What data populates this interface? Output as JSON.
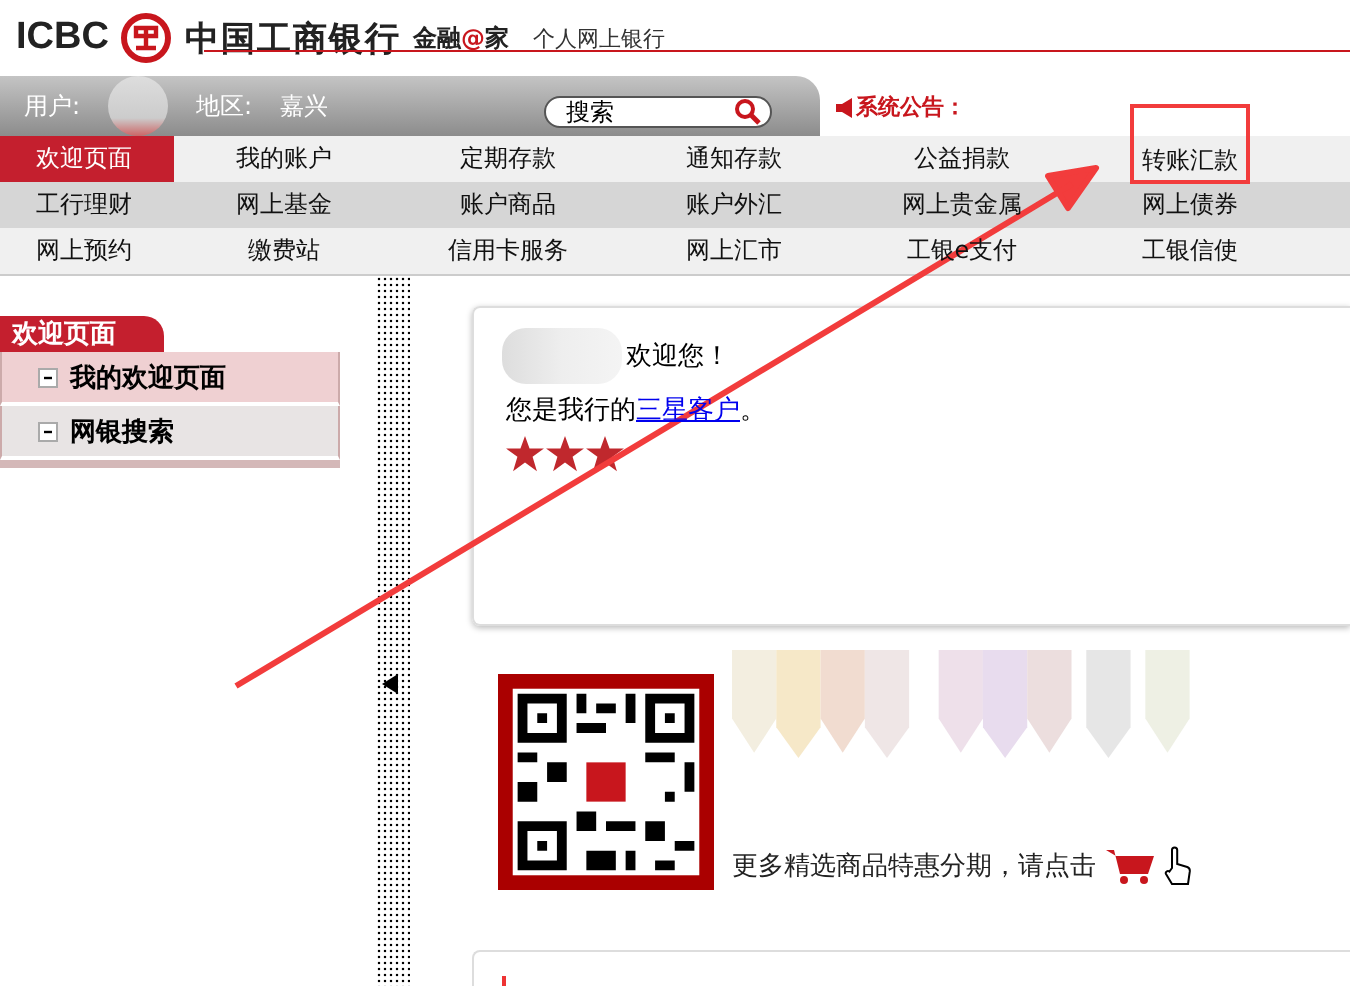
{
  "header": {
    "logo_text": "ICBC",
    "bank_name": "中国工商银行",
    "slogan_parts": [
      "金融",
      "@",
      "家"
    ],
    "subtitle": "个人网上银行"
  },
  "user_bar": {
    "user_label": "用户:",
    "region_label": "地区:",
    "region": "嘉兴",
    "search": {
      "placeholder": "搜索"
    },
    "notice": "系统公告："
  },
  "nav_rows": [
    [
      {
        "label": "欢迎页面",
        "selected": true,
        "highlighted": false
      },
      {
        "label": "我的账户",
        "selected": false,
        "highlighted": false
      },
      {
        "label": "定期存款",
        "selected": false,
        "highlighted": false
      },
      {
        "label": "通知存款",
        "selected": false,
        "highlighted": false
      },
      {
        "label": "公益捐款",
        "selected": false,
        "highlighted": false
      },
      {
        "label": "转账汇款",
        "selected": false,
        "highlighted": true
      }
    ],
    [
      {
        "label": "工行理财",
        "selected": false,
        "highlighted": false
      },
      {
        "label": "网上基金",
        "selected": false,
        "highlighted": false
      },
      {
        "label": "账户商品",
        "selected": false,
        "highlighted": false
      },
      {
        "label": "账户外汇",
        "selected": false,
        "highlighted": false
      },
      {
        "label": "网上贵金属",
        "selected": false,
        "highlighted": false
      },
      {
        "label": "网上债券",
        "selected": false,
        "highlighted": false
      }
    ],
    [
      {
        "label": "网上预约",
        "selected": false,
        "highlighted": false
      },
      {
        "label": "缴费站",
        "selected": false,
        "highlighted": false
      },
      {
        "label": "信用卡服务",
        "selected": false,
        "highlighted": false
      },
      {
        "label": "网上汇市",
        "selected": false,
        "highlighted": false
      },
      {
        "label": "工银e支付",
        "selected": false,
        "highlighted": false
      },
      {
        "label": "工银信使",
        "selected": false,
        "highlighted": false
      }
    ]
  ],
  "sidebar": {
    "title": "欢迎页面",
    "items": [
      {
        "label": "我的欢迎页面",
        "selected": true
      },
      {
        "label": "网银搜索",
        "selected": false
      }
    ]
  },
  "welcome": {
    "greeting": "欢迎您！",
    "text_before": "您是我行的",
    "link": "三星客户",
    "text_after": "。",
    "stars": 3
  },
  "promo": {
    "text": "更多精选商品特惠分期，请点击"
  }
}
